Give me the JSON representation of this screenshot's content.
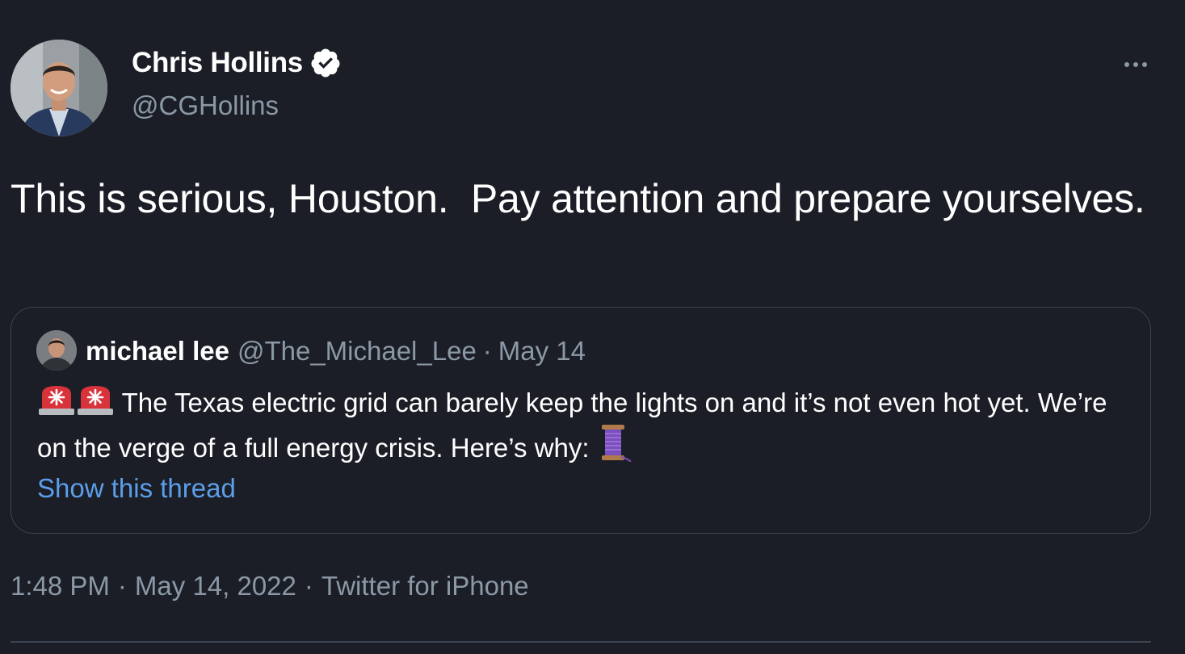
{
  "author": {
    "display_name": "Chris Hollins",
    "handle": "@CGHollins",
    "verified_icon": "verified-badge-icon"
  },
  "tweet": {
    "text": "This is serious, Houston.  Pay attention and prepare yourselves."
  },
  "quote": {
    "display_name": "michael lee",
    "handle": "@The_Michael_Lee",
    "separator": "·",
    "date": "May 14",
    "lead_emoji": [
      "rotating-light-emoji",
      "rotating-light-emoji"
    ],
    "text": "The Texas electric grid can barely keep the lights on and it’s not even hot yet. We’re on the verge of a full energy crisis. Here’s why:",
    "trail_emoji": "thread-emoji",
    "show_thread_label": "Show this thread"
  },
  "meta": {
    "time": "1:48 PM",
    "separator": "·",
    "date": "May 14, 2022",
    "source": "Twitter for iPhone"
  },
  "colors": {
    "background": "#1b1e26",
    "text_primary": "#ffffff",
    "text_secondary": "#8b98a5",
    "link": "#5b9ee9",
    "border": "#3d4451"
  }
}
